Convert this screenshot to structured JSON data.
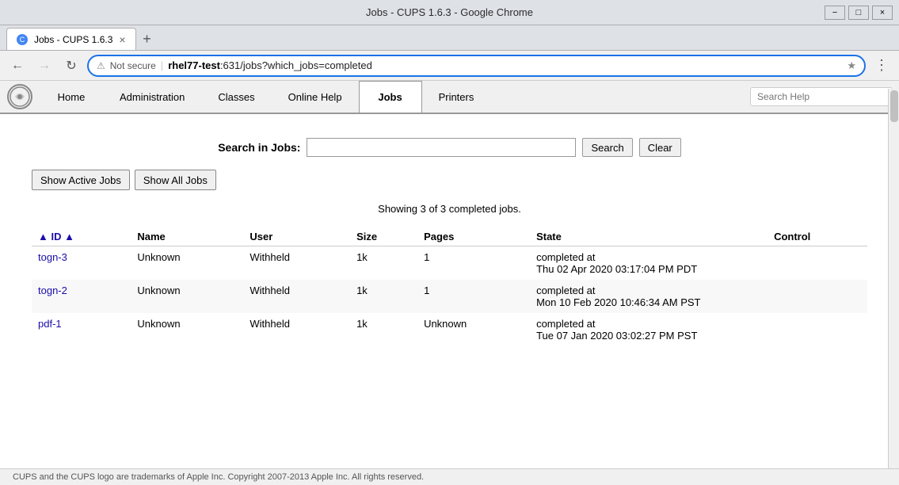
{
  "window": {
    "title": "Jobs - CUPS 1.6.3 - Google Chrome",
    "minimize": "−",
    "maximize": "□",
    "close": "×"
  },
  "browser": {
    "tab_title": "Jobs - CUPS 1.6.3",
    "new_tab_icon": "+",
    "back_disabled": false,
    "forward_disabled": true,
    "reload_icon": "↻",
    "url_security": "Not secure",
    "url_domain": "rhel77-test",
    "url_path": ":631/jobs?which_jobs=completed",
    "bookmark_icon": "★",
    "menu_icon": "⋮"
  },
  "nav": {
    "logo_text": "©",
    "items": [
      {
        "id": "home",
        "label": "Home",
        "active": false
      },
      {
        "id": "administration",
        "label": "Administration",
        "active": false
      },
      {
        "id": "classes",
        "label": "Classes",
        "active": false
      },
      {
        "id": "online-help",
        "label": "Online Help",
        "active": false
      },
      {
        "id": "jobs",
        "label": "Jobs",
        "active": true
      },
      {
        "id": "printers",
        "label": "Printers",
        "active": false
      }
    ],
    "search_help_placeholder": "Search Help"
  },
  "search": {
    "label": "Search in Jobs:",
    "input_value": "",
    "search_button": "Search",
    "clear_button": "Clear"
  },
  "job_buttons": [
    {
      "id": "show-active",
      "label": "Show Active Jobs"
    },
    {
      "id": "show-all",
      "label": "Show All Jobs"
    }
  ],
  "showing_text": "Showing 3 of 3 completed jobs.",
  "table": {
    "headers": [
      {
        "id": "id",
        "label": "▲ ID ▲",
        "link": true
      },
      {
        "id": "name",
        "label": "Name"
      },
      {
        "id": "user",
        "label": "User"
      },
      {
        "id": "size",
        "label": "Size"
      },
      {
        "id": "pages",
        "label": "Pages"
      },
      {
        "id": "state",
        "label": "State"
      },
      {
        "id": "control",
        "label": "Control"
      }
    ],
    "rows": [
      {
        "id": "togn-3",
        "name": "Unknown",
        "user": "Withheld",
        "size": "1k",
        "pages": "1",
        "state": "completed at",
        "state2": "Thu 02 Apr 2020 03:17:04 PM PDT",
        "control": ""
      },
      {
        "id": "togn-2",
        "name": "Unknown",
        "user": "Withheld",
        "size": "1k",
        "pages": "1",
        "state": "completed at",
        "state2": "Mon 10 Feb 2020 10:46:34 AM PST",
        "control": ""
      },
      {
        "id": "pdf-1",
        "name": "Unknown",
        "user": "Withheld",
        "size": "1k",
        "pages": "Unknown",
        "state": "completed at",
        "state2": "Tue 07 Jan 2020 03:02:27 PM PST",
        "control": ""
      }
    ]
  },
  "footer": {
    "text": "CUPS and the CUPS logo are trademarks of Apple Inc. Copyright 2007-2013 Apple Inc. All rights reserved."
  }
}
